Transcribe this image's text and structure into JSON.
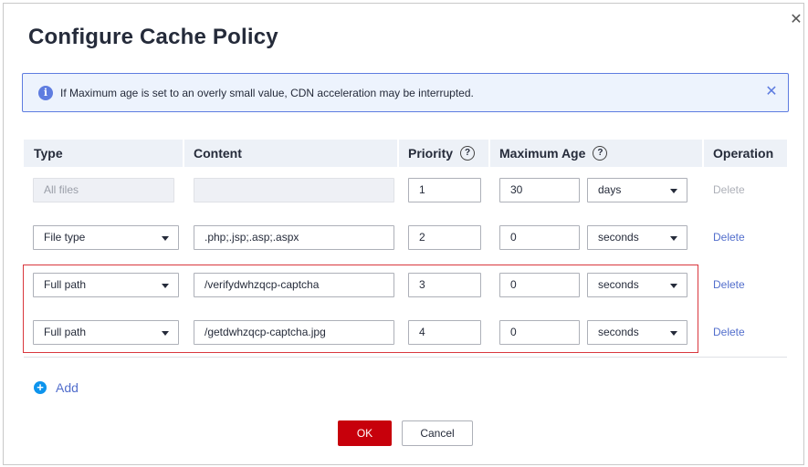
{
  "dialog": {
    "title": "Configure Cache Policy",
    "close_icon": "close-icon"
  },
  "info": {
    "icon": "info-icon",
    "icon_glyph": "i",
    "text": "If Maximum age is set to an overly small value, CDN acceleration may be interrupted.",
    "close_icon": "close-icon"
  },
  "table": {
    "headers": {
      "type": "Type",
      "content": "Content",
      "priority": "Priority",
      "max_age": "Maximum Age",
      "operation": "Operation",
      "help_glyph": "?"
    },
    "rows": [
      {
        "type": "All files",
        "type_disabled": true,
        "content": "",
        "content_disabled": true,
        "priority": "1",
        "age": "30",
        "unit": "days",
        "delete": "Delete",
        "delete_enabled": false
      },
      {
        "type": "File type",
        "type_disabled": false,
        "content": ".php;.jsp;.asp;.aspx",
        "content_disabled": false,
        "priority": "2",
        "age": "0",
        "unit": "seconds",
        "delete": "Delete",
        "delete_enabled": true
      },
      {
        "type": "Full path",
        "type_disabled": false,
        "content": "/verifydwhzqcp-captcha",
        "content_disabled": false,
        "priority": "3",
        "age": "0",
        "unit": "seconds",
        "delete": "Delete",
        "delete_enabled": true
      },
      {
        "type": "Full path",
        "type_disabled": false,
        "content": "/getdwhzqcp-captcha.jpg",
        "content_disabled": false,
        "priority": "4",
        "age": "0",
        "unit": "seconds",
        "delete": "Delete",
        "delete_enabled": true
      }
    ]
  },
  "add": {
    "label": "Add",
    "icon_glyph": "+"
  },
  "buttons": {
    "ok": "OK",
    "cancel": "Cancel"
  },
  "colors": {
    "primary_red": "#c7000b",
    "link_blue": "#526ecc",
    "info_border": "#5e7ce0",
    "info_bg": "#edf3fd",
    "highlight_border": "#d9373d"
  }
}
